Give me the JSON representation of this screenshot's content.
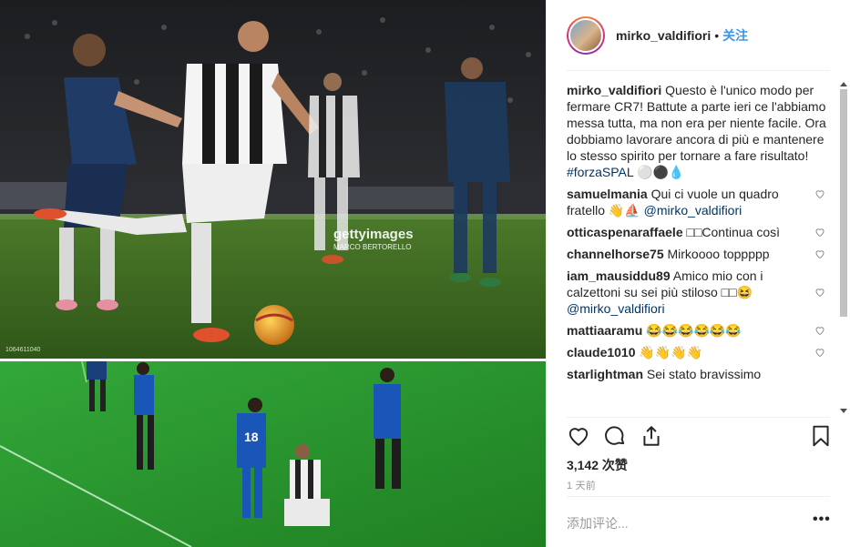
{
  "photo": {
    "watermark_brand": "gettyimages",
    "watermark_credit": "MARCO BERTORELLO",
    "image_code": "1064611040",
    "colors": {
      "pitch_top": "#3d6b22",
      "pitch_bottom": "#2f9a2c",
      "crowd": "#232529"
    }
  },
  "header": {
    "username": "mirko_valdifiori",
    "separator": "•",
    "follow_label": "关注"
  },
  "caption": {
    "username": "mirko_valdifiori",
    "text": "Questo è l'unico modo per fermare CR7! Battute a parte ieri ce l'abbiamo messa tutta, ma non era per niente facile. Ora dobbiamo lavorare ancora di più e mantenere lo stesso spirito per tornare a fare risultato!",
    "hashtag": "#forzaSPAL",
    "emoji": "⚪⚫💧"
  },
  "comments": [
    {
      "username": "samuelmania",
      "text": "Qui ci vuole un quadro fratello 👋⛵",
      "mention": "@mirko_valdifiori"
    },
    {
      "username": "otticaspenaraffaele",
      "text": "□□Continua così",
      "mention": ""
    },
    {
      "username": "channelhorse75",
      "text": "Mirkoooo toppppp",
      "mention": ""
    },
    {
      "username": "iam_mausiddu89",
      "text": "Amico mio con i calzettoni su sei più stiloso □□😆",
      "mention": "@mirko_valdifiori"
    },
    {
      "username": "mattiaaramu",
      "text": "😂😂😂😂😂😂",
      "mention": ""
    },
    {
      "username": "claude1010",
      "text": "👋👋👋👋",
      "mention": ""
    },
    {
      "username": "starlightman",
      "text": "Sei stato bravissimo",
      "mention": ""
    }
  ],
  "icons": {
    "like": "heart-icon",
    "comment": "comment-bubble-icon",
    "share": "share-icon",
    "save": "bookmark-icon",
    "more": "more-dots-icon"
  },
  "stats": {
    "likes": "3,142 次赞",
    "time": "1 天前"
  },
  "add_comment": {
    "placeholder": "添加评论...",
    "more_label": "•••"
  },
  "colors": {
    "link": "#003569",
    "follow": "#3897f0",
    "muted": "#999999",
    "border": "#efefef"
  }
}
